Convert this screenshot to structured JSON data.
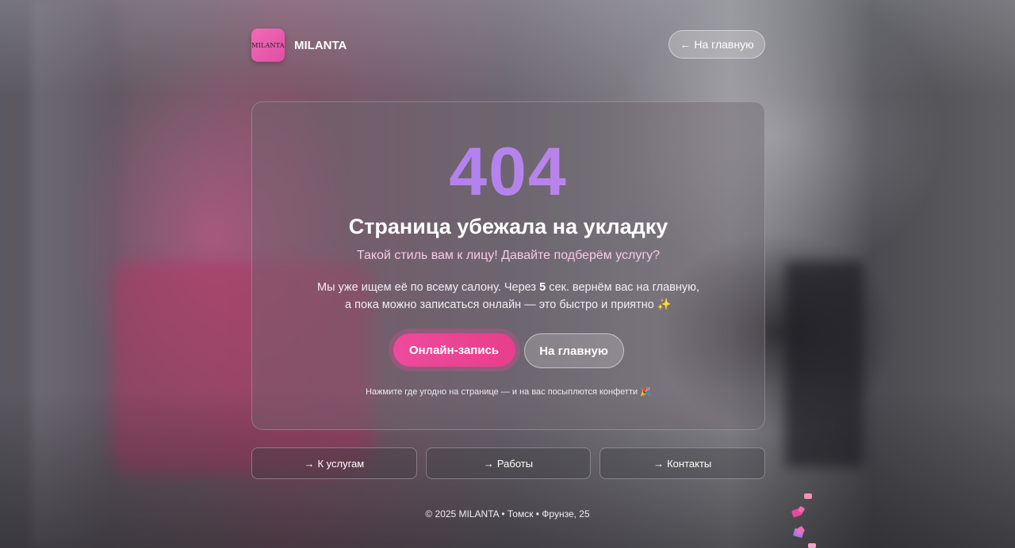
{
  "brand": {
    "logo_text": "MILANTA",
    "name": "MILANTA"
  },
  "header": {
    "home_label": "На главную",
    "home_arrow": "←"
  },
  "error": {
    "code": "404",
    "title": "Страница убежала на укладку",
    "subtitle": "Такой стиль вам к лицу! Давайте подберём услугу?",
    "desc_line1_before": "Мы уже ищем её по всему салону. Через ",
    "countdown": "5",
    "desc_line1_after": " сек. вернём вас на главную,",
    "desc_line2": "а пока можно записаться онлайн — это быстро и приятно ✨",
    "primary_button": "Онлайн-запись",
    "secondary_button": "На главную",
    "hint": "Нажмите где угодно на странице — и на вас посыплются конфетти 🎉"
  },
  "nav": {
    "arrow": "→",
    "items": [
      {
        "label": "К услугам"
      },
      {
        "label": "Работы"
      },
      {
        "label": "Контакты"
      }
    ]
  },
  "footer": {
    "text": "© 2025 MILANTA • Томск • Фрунзе, 25"
  },
  "colors": {
    "accent_pink": "#ec4899",
    "accent_purple": "#a87cf2"
  }
}
